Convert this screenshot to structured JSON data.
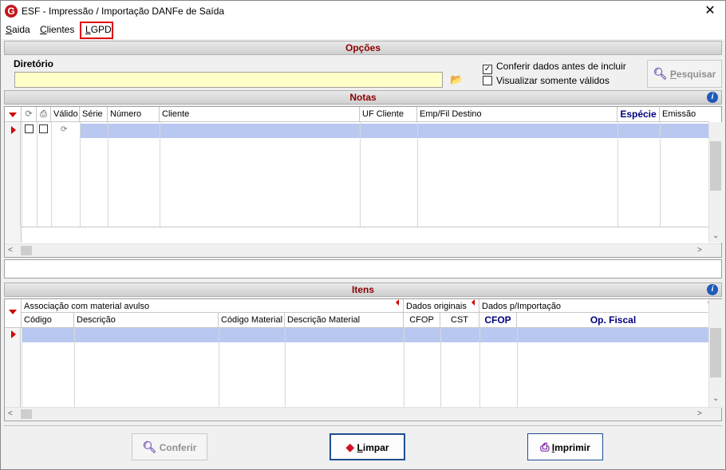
{
  "window": {
    "title": "ESF - Impressão / Importação DANFe de Saída",
    "logo_letter": "G",
    "close_glyph": "✕"
  },
  "menu": {
    "items": [
      {
        "label": "Saida",
        "accel": "S",
        "rest": "aida"
      },
      {
        "label": "Clientes",
        "accel": "C",
        "rest": "lientes"
      },
      {
        "label": "LGPD",
        "accel": "L",
        "rest": "GPD"
      }
    ]
  },
  "opcoes": {
    "header": "Opções",
    "diretorio_label": "Diretório",
    "diretorio_value": "",
    "conferir_label": "Conferir dados antes de incluir",
    "conferir_checked": true,
    "visualizar_label": "Visualizar somente válidos",
    "visualizar_checked": false,
    "pesquisar_accel": "P",
    "pesquisar_rest": "esquisar"
  },
  "notas": {
    "header": "Notas",
    "columns": [
      "Válido",
      "Série",
      "Número",
      "Cliente",
      "UF Cliente",
      "Emp/Fil Destino",
      "Espécie",
      "Emissão"
    ]
  },
  "itens": {
    "header": "Itens",
    "group_headers": [
      "Associação com material avulso",
      "Dados originais",
      "Dados p/Importação"
    ],
    "columns": [
      "Código",
      "Descrição",
      "Código Material",
      "Descrição Material",
      "CFOP",
      "CST",
      "CFOP",
      "Op. Fiscal"
    ]
  },
  "buttons": {
    "conferir": "Conferir",
    "limpar_accel": "L",
    "limpar_rest": "impar",
    "imprimir_accel": "I",
    "imprimir_rest": "mprimir"
  },
  "colors": {
    "section_title": "#8b0000",
    "selection_row": "#b8c8f0",
    "input_bg": "#ffffc8",
    "highlight_box": "#e00000",
    "bold_header": "#000080"
  }
}
